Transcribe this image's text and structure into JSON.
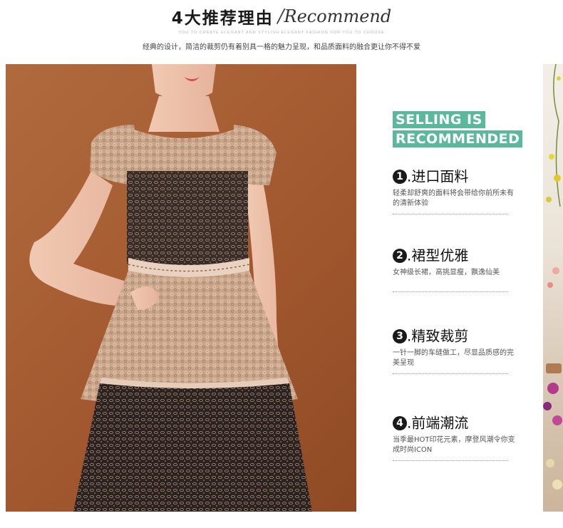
{
  "header": {
    "title_cn": "4大推荐理由",
    "title_slash": "/",
    "title_en": "Recommend",
    "subtitle_en": "YOU TO CREATE ELEGANT AND STYLISH ELEGANT FASHION FOR YOU TO CHOOSE",
    "subtitle_cn": "经典的设计，简洁的裁剪仍有着别具一格的魅力呈现，和品质面料的融合更让你不得不爱"
  },
  "badge": {
    "line1": "SELLING IS",
    "line2": "RECOMMENDED",
    "color": "#5bb89c"
  },
  "features": [
    {
      "num": "1",
      "suffix": ".",
      "title": "进口面料",
      "desc": "轻柔却舒爽的面料将会带给你前所未有的清新体验"
    },
    {
      "num": "2",
      "suffix": ".",
      "title": "裙型优雅",
      "desc": "女神级长裙，高挑显瘦，飘逸仙美"
    },
    {
      "num": "3",
      "suffix": ".",
      "title": "精致裁剪",
      "desc": "一针一脚的车缝做工，尽显品质感的完美呈现"
    },
    {
      "num": "4",
      "suffix": ".",
      "title": "前端潮流",
      "desc": "当季最HOT印花元素，摩登风潮令你变成时尚ICON"
    }
  ],
  "colors": {
    "photo_background": "#a45a30",
    "dress_lace": "#c9a58a",
    "dress_dark": "#2a2420",
    "accent_green": "#5bb89c"
  }
}
